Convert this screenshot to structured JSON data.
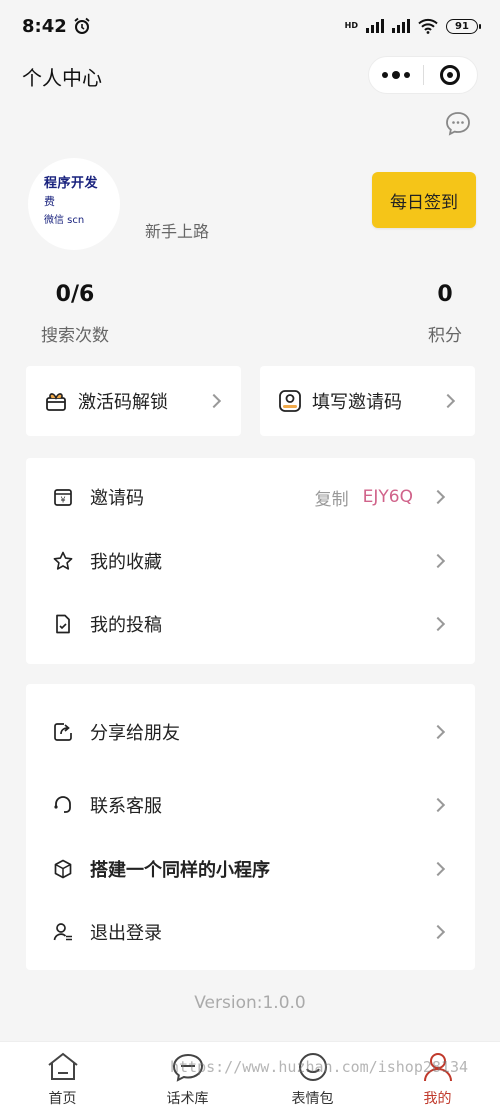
{
  "status_bar": {
    "time": "8:42",
    "hd": "HD",
    "battery": "91"
  },
  "nav": {
    "title": "个人中心"
  },
  "profile": {
    "avatar_line1": "程序开发",
    "avatar_line2": "费",
    "avatar_line3": "微信     scn",
    "level": "新手上路",
    "checkin_label": "每日签到"
  },
  "stats": {
    "search": {
      "value": "0/6",
      "label": "搜索次数"
    },
    "points": {
      "value": "0",
      "label": "积分"
    }
  },
  "quick_actions": {
    "activate": {
      "label": "激活码解锁",
      "icon": "gift-icon"
    },
    "invite": {
      "label": "填写邀请码",
      "icon": "user-badge-icon"
    }
  },
  "menu_group_1": {
    "invite_code": {
      "label": "邀请码",
      "copy": "复制",
      "code": "EJY6Q",
      "icon": "wallet-icon"
    },
    "favorites": {
      "label": "我的收藏",
      "icon": "star-icon"
    },
    "submissions": {
      "label": "我的投稿",
      "icon": "document-icon"
    }
  },
  "menu_group_2": {
    "share": {
      "label": "分享给朋友",
      "icon": "share-icon"
    },
    "support": {
      "label": "联系客服",
      "icon": "headset-icon"
    },
    "build": {
      "label": "搭建一个同样的小程序",
      "icon": "cube-icon"
    },
    "logout": {
      "label": "退出登录",
      "icon": "user-logout-icon"
    }
  },
  "version": "Version:1.0.0",
  "tab_bar": {
    "tabs": [
      {
        "label": "首页",
        "icon": "home-icon"
      },
      {
        "label": "话术库",
        "icon": "chat-icon"
      },
      {
        "label": "表情包",
        "icon": "smile-icon"
      },
      {
        "label": "我的",
        "icon": "user-icon"
      }
    ],
    "active_index": 3
  },
  "watermark": "https://www.huzhan.com/ishop28134",
  "colors": {
    "accent": "#c0392b",
    "checkin": "#f5c518",
    "code": "#d0638a"
  }
}
